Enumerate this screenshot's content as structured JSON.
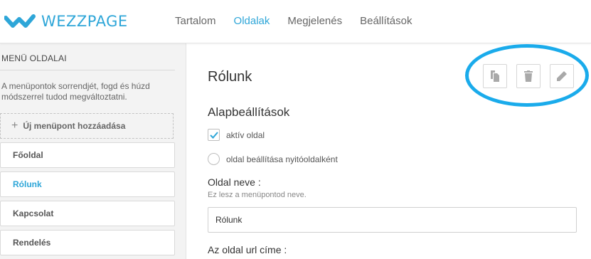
{
  "app": {
    "logo_text": "WEZZPAGE",
    "accent_color": "#2ea6d8",
    "highlight_color": "#1aabeb"
  },
  "nav": {
    "items": [
      {
        "label": "Tartalom",
        "active": false
      },
      {
        "label": "Oldalak",
        "active": true
      },
      {
        "label": "Megjelenés",
        "active": false
      },
      {
        "label": "Beállítások",
        "active": false
      }
    ]
  },
  "sidebar": {
    "title": "MENÜ OLDALAI",
    "help": "A menüpontok sorrendjét, fogd és húzd módszerrel tudod megváltoztatni.",
    "add_label": "Új menüpont hozzáadása",
    "add_icon": "plus-icon",
    "pages": [
      {
        "label": "Főoldal",
        "active": false
      },
      {
        "label": "Rólunk",
        "active": true
      },
      {
        "label": "Kapcsolat",
        "active": false
      },
      {
        "label": "Rendelés",
        "active": false
      }
    ]
  },
  "main": {
    "page_title": "Rólunk",
    "actions": [
      {
        "name": "duplicate",
        "icon": "copy-icon"
      },
      {
        "name": "delete",
        "icon": "trash-icon"
      },
      {
        "name": "edit",
        "icon": "pencil-icon"
      }
    ],
    "section_title": "Alapbeállítások",
    "active_checkbox": {
      "label": "aktív oldal",
      "checked": true
    },
    "homepage_radio": {
      "label": "oldal beállítása nyitóoldalként",
      "checked": false
    },
    "name_field": {
      "label": "Oldal neve :",
      "help": "Ez lesz a menüpontod neve.",
      "value": "Rólunk"
    },
    "url_field": {
      "label": "Az oldal url címe :"
    }
  }
}
